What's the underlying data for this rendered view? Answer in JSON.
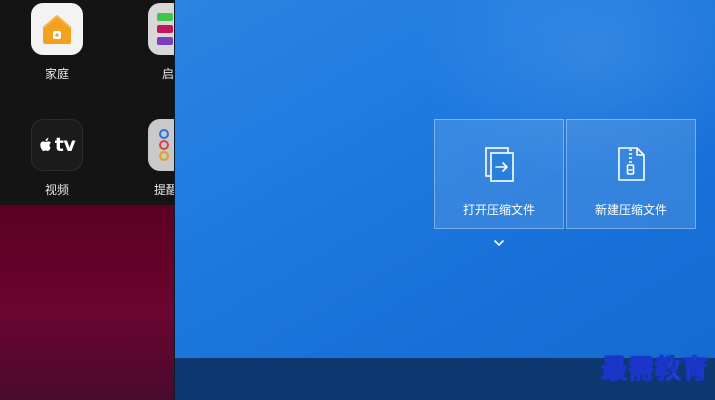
{
  "launchpad": {
    "apps": [
      {
        "label": "家庭",
        "icon": "home-icon"
      },
      {
        "label": "启",
        "icon": "reminders-icon"
      },
      {
        "label": "视频",
        "icon": "apple-tv-icon",
        "glyph": "tv"
      },
      {
        "label": "提醒",
        "icon": "reminders-icon"
      }
    ]
  },
  "window": {
    "cards": [
      {
        "label": "打开压缩文件",
        "icon": "open-archive-icon"
      },
      {
        "label": "新建压缩文件",
        "icon": "new-archive-icon"
      }
    ],
    "expand_icon": "chevron-down-icon"
  },
  "watermark": {
    "text": "最需教育"
  },
  "colors": {
    "window_bg": "#1f7be0",
    "taskbar": "#0d3970",
    "wallpaper": "#5c0022",
    "launchpad_bg": "#141414",
    "home_icon_accent": "#f4a020",
    "watermark_stroke": "#1a35c8"
  }
}
